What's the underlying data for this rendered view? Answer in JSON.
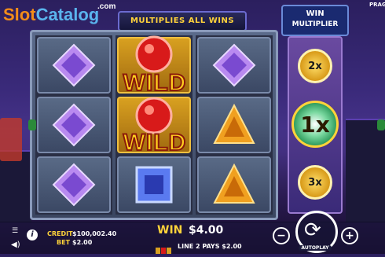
{
  "watermark": {
    "slot": "Slot",
    "catalog": "Catalog",
    "com": ".com"
  },
  "banner": {
    "text": "MULTIPLIES ALL WINS"
  },
  "provider": "PRAG",
  "reels": {
    "columns": [
      {
        "symbols": [
          "purple-gem",
          "purple-gem",
          "purple-gem"
        ]
      },
      {
        "symbols": [
          "wild-red-gem",
          "wild-red-gem",
          "blue-gem"
        ],
        "wild_label": "WILD"
      },
      {
        "symbols": [
          "purple-gem",
          "orange-gem",
          "orange-gem"
        ]
      }
    ]
  },
  "multiplier": {
    "title_top": "WIN",
    "title_bottom": "MULTIPLIER",
    "values": [
      "2x",
      "1x",
      "3x"
    ],
    "active": "1x"
  },
  "bottom_bar": {
    "credit_label": "CREDIT",
    "credit_value": "$100,002.40",
    "bet_label": "BET",
    "bet_value": "$2.00",
    "win_label": "WIN",
    "win_value": "$4.00",
    "line_text": "LINE 2 PAYS $2.00",
    "autoplay_label": "AUTOPLAY",
    "minus": "−",
    "plus": "+"
  },
  "colors": {
    "gold": "#ffd33a",
    "purple_gem": "#9a6ae0",
    "red_gem": "#d81a1a",
    "orange_gem": "#f0a020",
    "blue_gem": "#3a5ad8"
  }
}
